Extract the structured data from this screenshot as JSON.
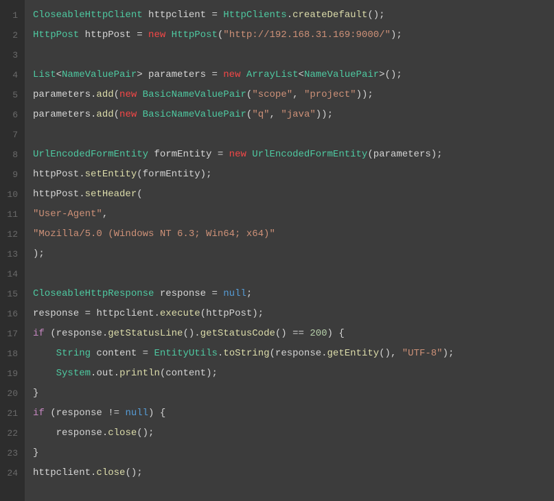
{
  "code": {
    "lines": [
      [
        {
          "t": "type",
          "v": "CloseableHttpClient"
        },
        {
          "t": "default",
          "v": " httpclient "
        },
        {
          "t": "punct",
          "v": "= "
        },
        {
          "t": "type",
          "v": "HttpClients"
        },
        {
          "t": "punct",
          "v": "."
        },
        {
          "t": "method",
          "v": "createDefault"
        },
        {
          "t": "punct",
          "v": "();"
        }
      ],
      [
        {
          "t": "type",
          "v": "HttpPost"
        },
        {
          "t": "default",
          "v": " httpPost "
        },
        {
          "t": "punct",
          "v": "= "
        },
        {
          "t": "new",
          "v": "new"
        },
        {
          "t": "default",
          "v": " "
        },
        {
          "t": "type",
          "v": "HttpPost"
        },
        {
          "t": "punct",
          "v": "("
        },
        {
          "t": "string",
          "v": "\"http://192.168.31.169:9000/\""
        },
        {
          "t": "punct",
          "v": ");"
        }
      ],
      [],
      [
        {
          "t": "type",
          "v": "List"
        },
        {
          "t": "punct",
          "v": "<"
        },
        {
          "t": "type",
          "v": "NameValuePair"
        },
        {
          "t": "punct",
          "v": "> "
        },
        {
          "t": "default",
          "v": "parameters "
        },
        {
          "t": "punct",
          "v": "= "
        },
        {
          "t": "new",
          "v": "new"
        },
        {
          "t": "default",
          "v": " "
        },
        {
          "t": "type",
          "v": "ArrayList"
        },
        {
          "t": "punct",
          "v": "<"
        },
        {
          "t": "type",
          "v": "NameValuePair"
        },
        {
          "t": "punct",
          "v": ">();"
        }
      ],
      [
        {
          "t": "default",
          "v": "parameters"
        },
        {
          "t": "punct",
          "v": "."
        },
        {
          "t": "method",
          "v": "add"
        },
        {
          "t": "punct",
          "v": "("
        },
        {
          "t": "new",
          "v": "new"
        },
        {
          "t": "default",
          "v": " "
        },
        {
          "t": "type",
          "v": "BasicNameValuePair"
        },
        {
          "t": "punct",
          "v": "("
        },
        {
          "t": "string",
          "v": "\"scope\""
        },
        {
          "t": "punct",
          "v": ", "
        },
        {
          "t": "string",
          "v": "\"project\""
        },
        {
          "t": "punct",
          "v": "));"
        }
      ],
      [
        {
          "t": "default",
          "v": "parameters"
        },
        {
          "t": "punct",
          "v": "."
        },
        {
          "t": "method",
          "v": "add"
        },
        {
          "t": "punct",
          "v": "("
        },
        {
          "t": "new",
          "v": "new"
        },
        {
          "t": "default",
          "v": " "
        },
        {
          "t": "type",
          "v": "BasicNameValuePair"
        },
        {
          "t": "punct",
          "v": "("
        },
        {
          "t": "string",
          "v": "\"q\""
        },
        {
          "t": "punct",
          "v": ", "
        },
        {
          "t": "string",
          "v": "\"java\""
        },
        {
          "t": "punct",
          "v": "));"
        }
      ],
      [],
      [
        {
          "t": "type",
          "v": "UrlEncodedFormEntity"
        },
        {
          "t": "default",
          "v": " formEntity "
        },
        {
          "t": "punct",
          "v": "= "
        },
        {
          "t": "new",
          "v": "new"
        },
        {
          "t": "default",
          "v": " "
        },
        {
          "t": "type",
          "v": "UrlEncodedFormEntity"
        },
        {
          "t": "punct",
          "v": "(parameters);"
        }
      ],
      [
        {
          "t": "default",
          "v": "httpPost"
        },
        {
          "t": "punct",
          "v": "."
        },
        {
          "t": "method",
          "v": "setEntity"
        },
        {
          "t": "punct",
          "v": "(formEntity);"
        }
      ],
      [
        {
          "t": "default",
          "v": "httpPost"
        },
        {
          "t": "punct",
          "v": "."
        },
        {
          "t": "method",
          "v": "setHeader"
        },
        {
          "t": "punct",
          "v": "("
        }
      ],
      [
        {
          "t": "string",
          "v": "\"User-Agent\""
        },
        {
          "t": "punct",
          "v": ","
        }
      ],
      [
        {
          "t": "string",
          "v": "\"Mozilla/5.0 (Windows NT 6.3; Win64; x64)\""
        }
      ],
      [
        {
          "t": "punct",
          "v": ");"
        }
      ],
      [],
      [
        {
          "t": "type",
          "v": "CloseableHttpResponse"
        },
        {
          "t": "default",
          "v": " response "
        },
        {
          "t": "punct",
          "v": "= "
        },
        {
          "t": "null",
          "v": "null"
        },
        {
          "t": "punct",
          "v": ";"
        }
      ],
      [
        {
          "t": "default",
          "v": "response "
        },
        {
          "t": "punct",
          "v": "= "
        },
        {
          "t": "default",
          "v": "httpclient"
        },
        {
          "t": "punct",
          "v": "."
        },
        {
          "t": "method",
          "v": "execute"
        },
        {
          "t": "punct",
          "v": "(httpPost);"
        }
      ],
      [
        {
          "t": "keyword",
          "v": "if"
        },
        {
          "t": "default",
          "v": " "
        },
        {
          "t": "punct",
          "v": "(response."
        },
        {
          "t": "method",
          "v": "getStatusLine"
        },
        {
          "t": "punct",
          "v": "()."
        },
        {
          "t": "method",
          "v": "getStatusCode"
        },
        {
          "t": "punct",
          "v": "() == "
        },
        {
          "t": "number",
          "v": "200"
        },
        {
          "t": "punct",
          "v": ") {"
        }
      ],
      [
        {
          "t": "default",
          "v": "    "
        },
        {
          "t": "type",
          "v": "String"
        },
        {
          "t": "default",
          "v": " content "
        },
        {
          "t": "punct",
          "v": "= "
        },
        {
          "t": "type",
          "v": "EntityUtils"
        },
        {
          "t": "punct",
          "v": "."
        },
        {
          "t": "method",
          "v": "toString"
        },
        {
          "t": "punct",
          "v": "(response."
        },
        {
          "t": "method",
          "v": "getEntity"
        },
        {
          "t": "punct",
          "v": "(), "
        },
        {
          "t": "string",
          "v": "\"UTF-8\""
        },
        {
          "t": "punct",
          "v": ");"
        }
      ],
      [
        {
          "t": "default",
          "v": "    "
        },
        {
          "t": "type",
          "v": "System"
        },
        {
          "t": "punct",
          "v": "."
        },
        {
          "t": "default",
          "v": "out"
        },
        {
          "t": "punct",
          "v": "."
        },
        {
          "t": "method",
          "v": "println"
        },
        {
          "t": "punct",
          "v": "(content);"
        }
      ],
      [
        {
          "t": "punct",
          "v": "}"
        }
      ],
      [
        {
          "t": "keyword",
          "v": "if"
        },
        {
          "t": "default",
          "v": " "
        },
        {
          "t": "punct",
          "v": "(response != "
        },
        {
          "t": "null",
          "v": "null"
        },
        {
          "t": "punct",
          "v": ") {"
        }
      ],
      [
        {
          "t": "default",
          "v": "    response"
        },
        {
          "t": "punct",
          "v": "."
        },
        {
          "t": "method",
          "v": "close"
        },
        {
          "t": "punct",
          "v": "();"
        }
      ],
      [
        {
          "t": "punct",
          "v": "}"
        }
      ],
      [
        {
          "t": "default",
          "v": "httpclient"
        },
        {
          "t": "punct",
          "v": "."
        },
        {
          "t": "method",
          "v": "close"
        },
        {
          "t": "punct",
          "v": "();"
        }
      ]
    ]
  }
}
